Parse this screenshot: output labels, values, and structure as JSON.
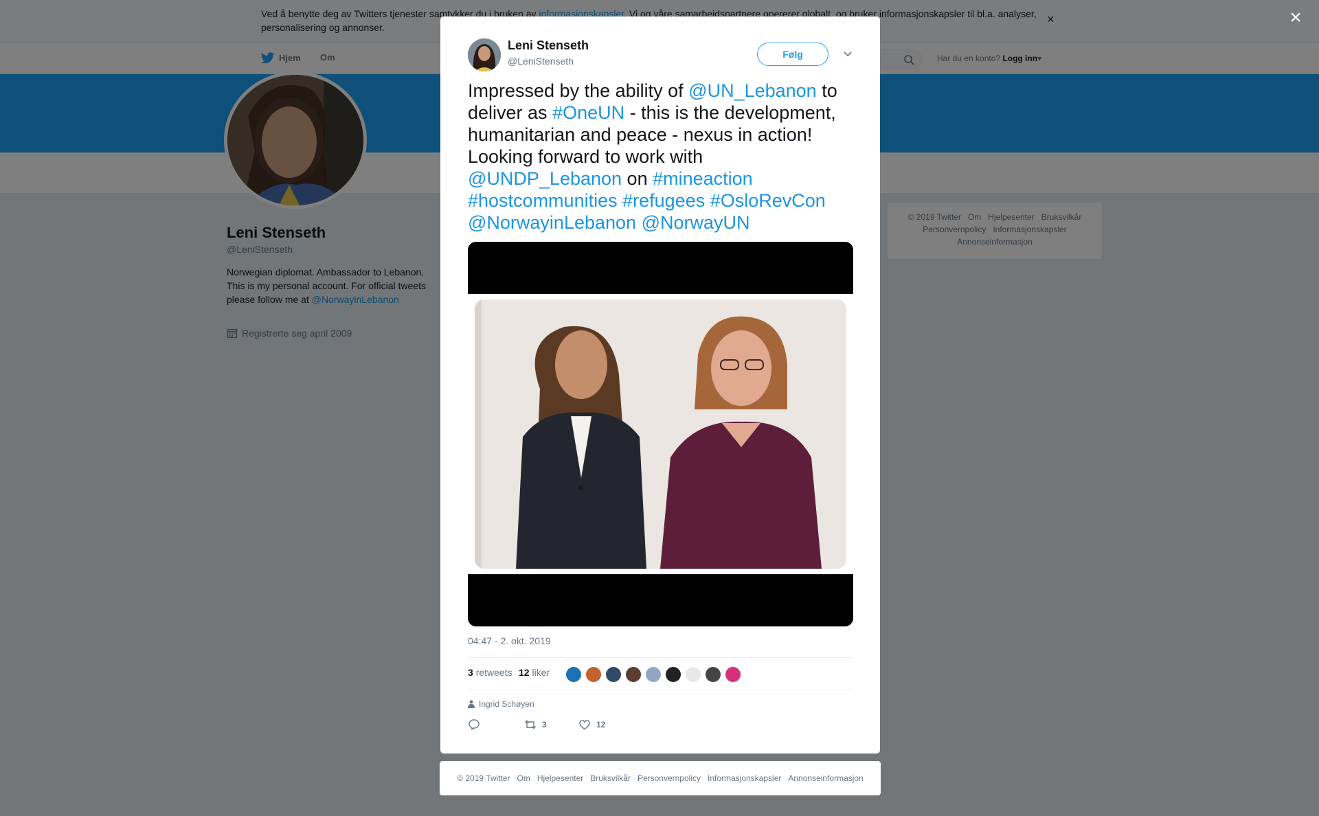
{
  "cookie_bar": {
    "text_before": "Ved å benytte deg av Twitters tjenester samtykker du i bruken av ",
    "link": "informasjonskapsler",
    "text_after": ". Vi og våre samarbeidspartnere opererer globalt, og bruker informasjonskapsler til bl.a. analyser, personalisering og annonser.",
    "close": "×"
  },
  "nav": {
    "home": "Hjem",
    "about": "Om",
    "login_prompt": "Har du en konto?",
    "login": "Logg inn"
  },
  "profile": {
    "name": "Leni Stenseth",
    "handle": "@LeniStenseth",
    "bio": "Norwegian diplomat. Ambassador to Lebanon. This is my personal account. For official tweets please follow me at ",
    "bio_link": "@NorwayinLebanon",
    "joined": "Registrerte seg april 2009"
  },
  "side_footer": [
    "© 2019 Twitter",
    "Om",
    "Hjelpesenter",
    "Bruksvilkår",
    "Personvernpolicy",
    "Informasjonskapsler",
    "Annonseinformasjon"
  ],
  "overlay_close": "×",
  "tweet": {
    "author_name": "Leni Stenseth",
    "author_handle": "@LeniStenseth",
    "follow": "Følg",
    "text_parts": [
      {
        "t": "Impressed by the ability of ",
        "link": false
      },
      {
        "t": "@UN_Lebanon",
        "link": true
      },
      {
        "t": " to deliver as ",
        "link": false
      },
      {
        "t": "#OneUN",
        "link": true
      },
      {
        "t": " - this is the development, humanitarian and peace - nexus in action! Looking forward to work with ",
        "link": false
      },
      {
        "t": "@UNDP_Lebanon",
        "link": true
      },
      {
        "t": " on ",
        "link": false
      },
      {
        "t": "#mineaction",
        "link": true
      },
      {
        "t": " ",
        "link": false
      },
      {
        "t": "#hostcommunities",
        "link": true
      },
      {
        "t": " ",
        "link": false
      },
      {
        "t": "#refugees",
        "link": true
      },
      {
        "t": " ",
        "link": false
      },
      {
        "t": "#OsloRevCon",
        "link": true
      },
      {
        "t": " ",
        "link": false
      },
      {
        "t": "@NorwayinLebanon",
        "link": true
      },
      {
        "t": " ",
        "link": false
      },
      {
        "t": "@NorwayUN",
        "link": true
      }
    ],
    "timestamp": "04:47 - 2. okt. 2019",
    "retweets_count": "3",
    "retweets_label": "retweets",
    "likes_count": "12",
    "likes_label": "liker",
    "liker_colors": [
      "#1f6fb5",
      "#c2622d",
      "#334a66",
      "#5a3d2e",
      "#8fa7c2",
      "#222222",
      "#e8e8e8",
      "#444444",
      "#d6307a"
    ],
    "context_user": "Ingrid Schøyen",
    "action_retweet_count": "3",
    "action_like_count": "12"
  },
  "modal_footer": [
    "© 2019 Twitter",
    "Om",
    "Hjelpesenter",
    "Bruksvilkår",
    "Personvernpolicy",
    "Informasjonskapsler",
    "Annonseinformasjon"
  ],
  "colors": {
    "accent": "#1da1f2",
    "link": "#1b95e0",
    "overlay": "rgba(0,0,0,0.5)"
  }
}
